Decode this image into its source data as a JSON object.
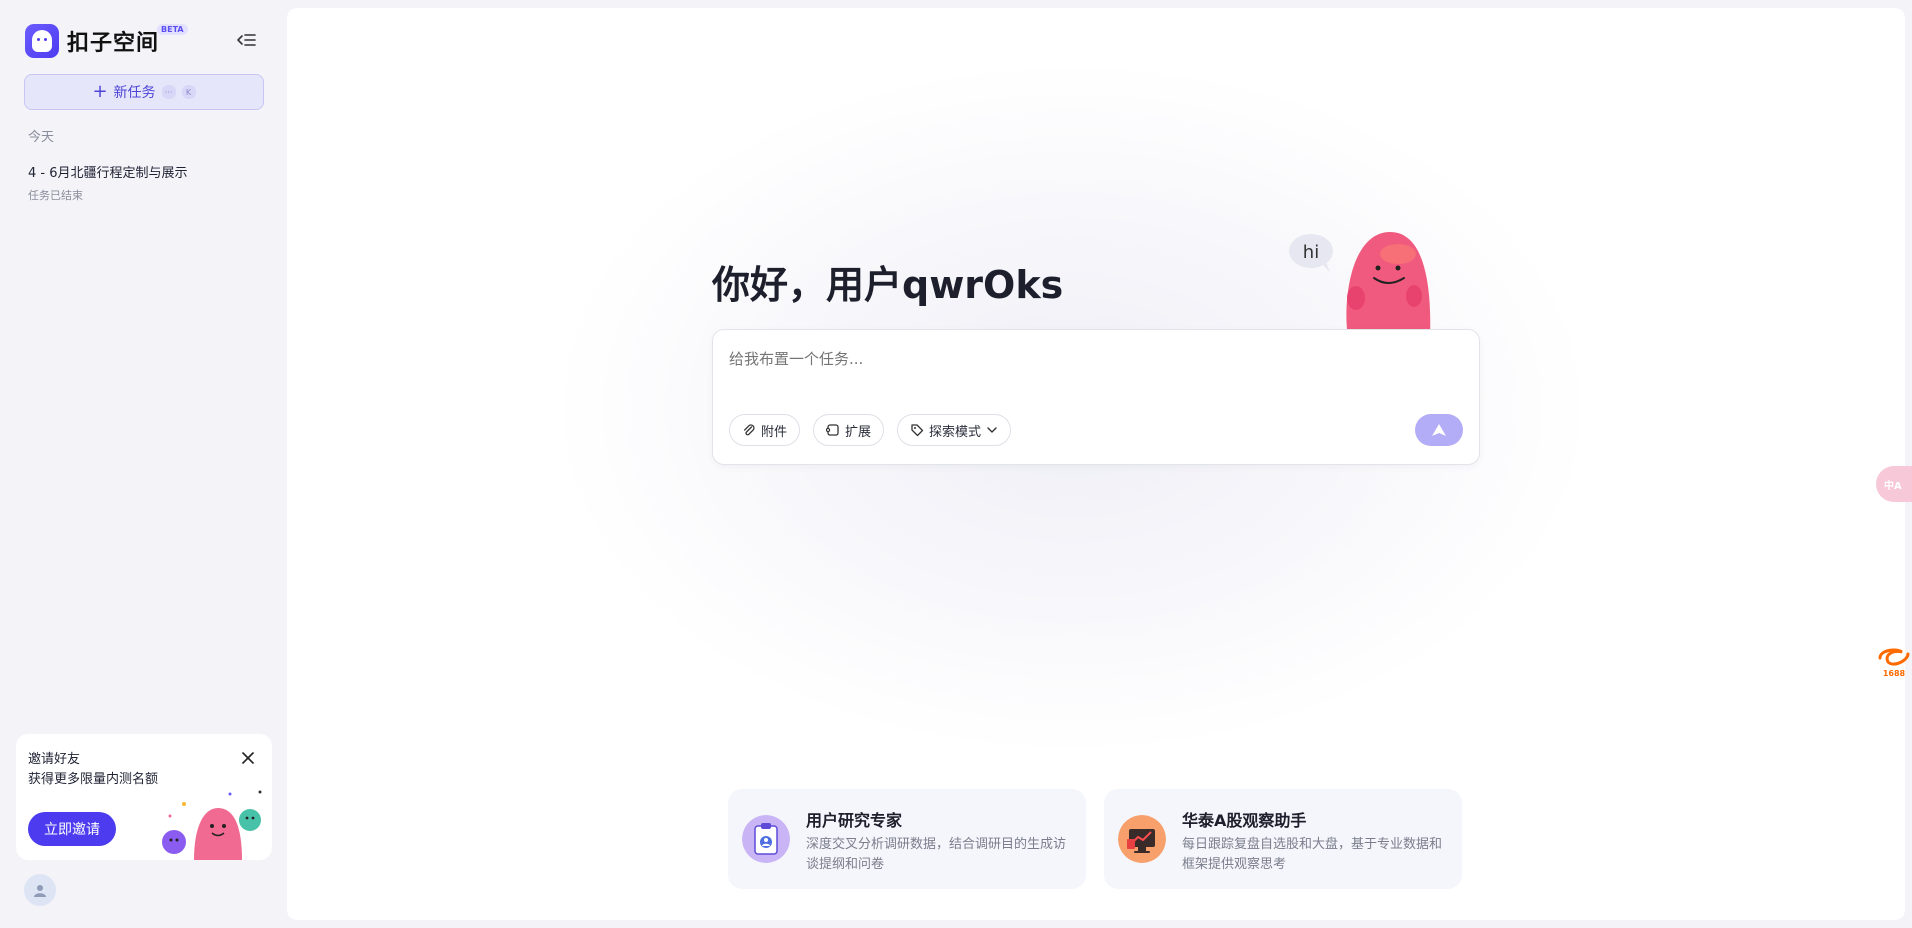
{
  "sidebar": {
    "brand_name": "扣子空间",
    "brand_badge": "BETA",
    "new_task_label": "新任务",
    "shortcut_keys": [
      "···",
      "K"
    ],
    "section_today": "今天",
    "history": [
      {
        "title": "4 - 6月北疆行程定制与展示",
        "status": "任务已结束"
      }
    ],
    "invite": {
      "title": "邀请好友",
      "subtitle": "获得更多限量内测名额",
      "button": "立即邀请"
    }
  },
  "main": {
    "greeting": "你好，用户qwrOks",
    "mascot_bubble": "hi",
    "composer": {
      "placeholder": "给我布置一个任务...",
      "chips": {
        "attach": "附件",
        "extend": "扩展",
        "explore": "探索模式"
      }
    },
    "agents": [
      {
        "name": "用户研究专家",
        "desc": "深度交叉分析调研数据，结合调研目的生成访谈提纲和问卷"
      },
      {
        "name": "华泰A股观察助手",
        "desc": "每日跟踪复盘自选股和大盘，基于专业数据和框架提供观察思考"
      }
    ]
  },
  "floating": {
    "translate_glyph": "中A",
    "badge_1688": "1688"
  },
  "colors": {
    "accent": "#4d3bf0",
    "accent_light": "#e6e6fb",
    "send_disabled": "#b3acf6",
    "mascot_pink": "#f05a7e"
  }
}
